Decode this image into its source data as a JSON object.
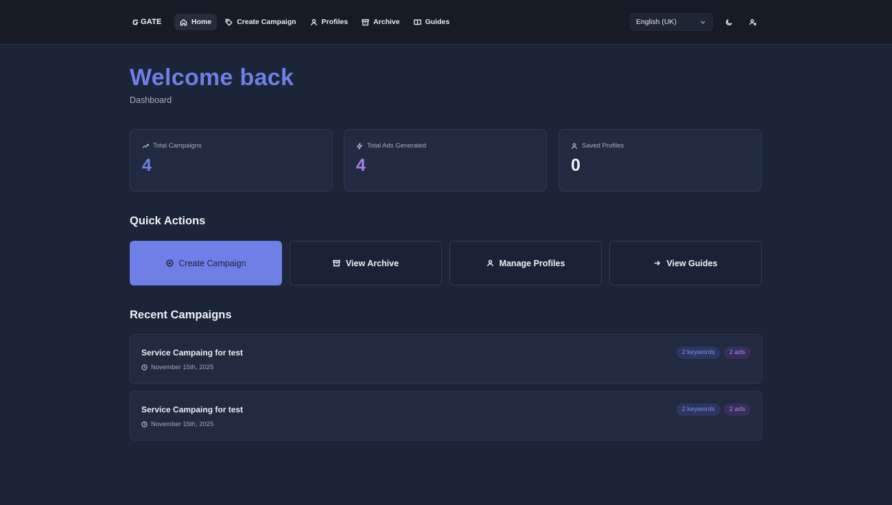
{
  "header": {
    "logo": "GATE",
    "nav": [
      {
        "label": "Home",
        "icon": "home-icon",
        "active": true
      },
      {
        "label": "Create Campaign",
        "icon": "tag-icon",
        "active": false
      },
      {
        "label": "Profiles",
        "icon": "user-icon",
        "active": false
      },
      {
        "label": "Archive",
        "icon": "archive-icon",
        "active": false
      },
      {
        "label": "Guides",
        "icon": "book-icon",
        "active": false
      }
    ],
    "language": "English (UK)",
    "theme_icon": "moon-icon",
    "account_icon": "user-settings-icon"
  },
  "page": {
    "title": "Welcome back",
    "subtitle": "Dashboard"
  },
  "stats": [
    {
      "label": "Total Campaigns",
      "value": "4",
      "icon": "trending-up-icon",
      "color": "#6f7fe6"
    },
    {
      "label": "Total Ads Generated",
      "value": "4",
      "icon": "zap-icon",
      "color": "#a67fe6"
    },
    {
      "label": "Saved Profiles",
      "value": "0",
      "icon": "user-icon",
      "color": "#f1f3f8"
    }
  ],
  "quick_actions": {
    "heading": "Quick Actions",
    "items": [
      {
        "label": "Create Campaign",
        "icon": "plus-circle-icon"
      },
      {
        "label": "View Archive",
        "icon": "archive-icon"
      },
      {
        "label": "Manage Profiles",
        "icon": "user-icon"
      },
      {
        "label": "View Guides",
        "icon": "arrow-right-icon"
      }
    ]
  },
  "recent": {
    "heading": "Recent Campaigns",
    "items": [
      {
        "title": "Service Campaing for test",
        "date": "November 15th, 2025",
        "keywords": "2 keywords",
        "ads": "2 ads"
      },
      {
        "title": "Service Campaing for test",
        "date": "November 15th, 2025",
        "keywords": "2 keywords",
        "ads": "2 ads"
      }
    ]
  },
  "colors": {
    "accent": "#6f7fe8",
    "background": "#1c2438",
    "header": "#161b25"
  }
}
